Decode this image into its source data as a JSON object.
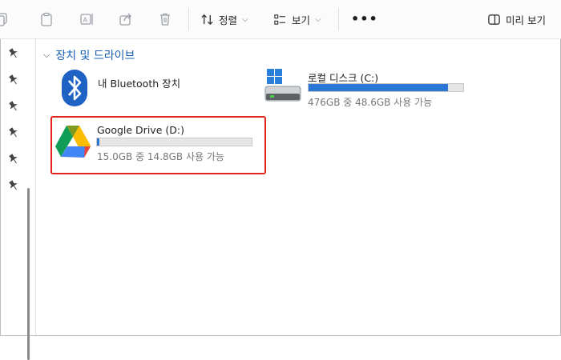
{
  "toolbar": {
    "sort_label": "정렬",
    "view_label": "보기",
    "preview_label": "미리 보기",
    "more_label": "•••"
  },
  "group": {
    "title": "장치 및 드라이브"
  },
  "devices": [
    {
      "name": "내 Bluetooth 장치",
      "icon": "bluetooth-icon"
    },
    {
      "name": "로컬 디스크 (C:)",
      "icon": "local-disk-icon",
      "usage_text": "476GB 중 48.6GB 사용 가능",
      "used_fraction": 0.9
    },
    {
      "name": "Google Drive (D:)",
      "icon": "google-drive-icon",
      "usage_text": "15.0GB 중 14.8GB 사용 가능",
      "used_fraction": 0.013
    }
  ],
  "colors": {
    "accent": "#2b78d4",
    "highlight": "#e0241b",
    "group_title": "#1a5fb4"
  }
}
